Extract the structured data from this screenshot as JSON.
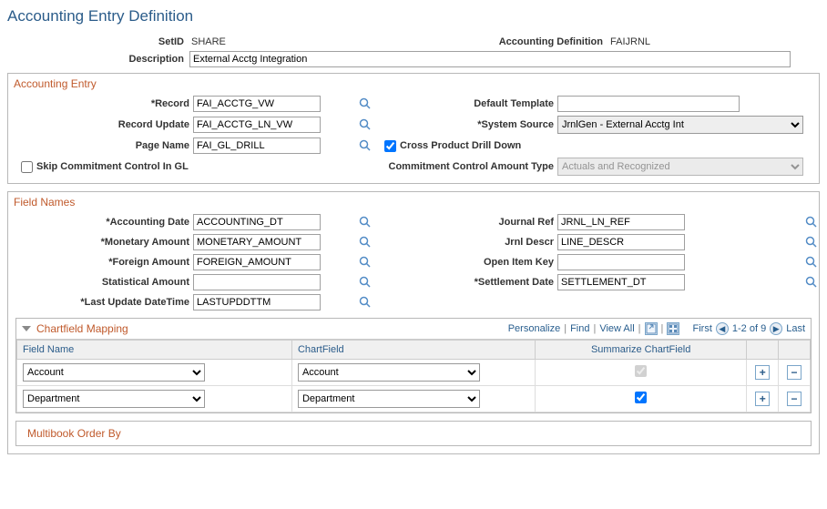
{
  "page_title": "Accounting Entry Definition",
  "header": {
    "setid_label": "SetID",
    "setid_value": "SHARE",
    "acct_def_label": "Accounting Definition",
    "acct_def_value": "FAIJRNL",
    "description_label": "Description",
    "description_value": "External Acctg Integration"
  },
  "accounting_entry": {
    "title": "Accounting Entry",
    "record_label": "*Record",
    "record_value": "FAI_ACCTG_VW",
    "default_template_label": "Default Template",
    "default_template_value": "",
    "record_update_label": "Record Update",
    "record_update_value": "FAI_ACCTG_LN_VW",
    "system_source_label": "*System Source",
    "system_source_value": "JrnlGen - External Acctg Int",
    "page_name_label": "Page Name",
    "page_name_value": "FAI_GL_DRILL",
    "cross_prod_label": "Cross Product Drill Down",
    "cross_prod_checked": true,
    "skip_cc_label": "Skip Commitment Control In GL",
    "skip_cc_checked": false,
    "cc_amount_type_label": "Commitment Control Amount Type",
    "cc_amount_type_value": "Actuals and Recognized"
  },
  "field_names": {
    "title": "Field Names",
    "acct_date_label": "*Accounting Date",
    "acct_date_value": "ACCOUNTING_DT",
    "journal_ref_label": "Journal Ref",
    "journal_ref_value": "JRNL_LN_REF",
    "monetary_amt_label": "*Monetary Amount",
    "monetary_amt_value": "MONETARY_AMOUNT",
    "jrnl_descr_label": "Jrnl Descr",
    "jrnl_descr_value": "LINE_DESCR",
    "foreign_amt_label": "*Foreign Amount",
    "foreign_amt_value": "FOREIGN_AMOUNT",
    "open_item_label": "Open Item Key",
    "open_item_value": "",
    "stat_amt_label": "Statistical Amount",
    "stat_amt_value": "",
    "settle_date_label": "*Settlement Date",
    "settle_date_value": "SETTLEMENT_DT",
    "last_upd_label": "*Last Update DateTime",
    "last_upd_value": "LASTUPDDTTM"
  },
  "chartfield_mapping": {
    "title": "Chartfield Mapping",
    "personalize": "Personalize",
    "find": "Find",
    "view_all": "View All",
    "first": "First",
    "counter": "1-2 of 9",
    "last": "Last",
    "col_fieldname": "Field Name",
    "col_chartfield": "ChartField",
    "col_summarize": "Summarize ChartField",
    "rows": [
      {
        "field_name": "Account",
        "chartfield": "Account",
        "summarize": true,
        "summarize_disabled": true
      },
      {
        "field_name": "Department",
        "chartfield": "Department",
        "summarize": true,
        "summarize_disabled": false
      }
    ]
  },
  "multibook": {
    "title": "Multibook Order By"
  }
}
